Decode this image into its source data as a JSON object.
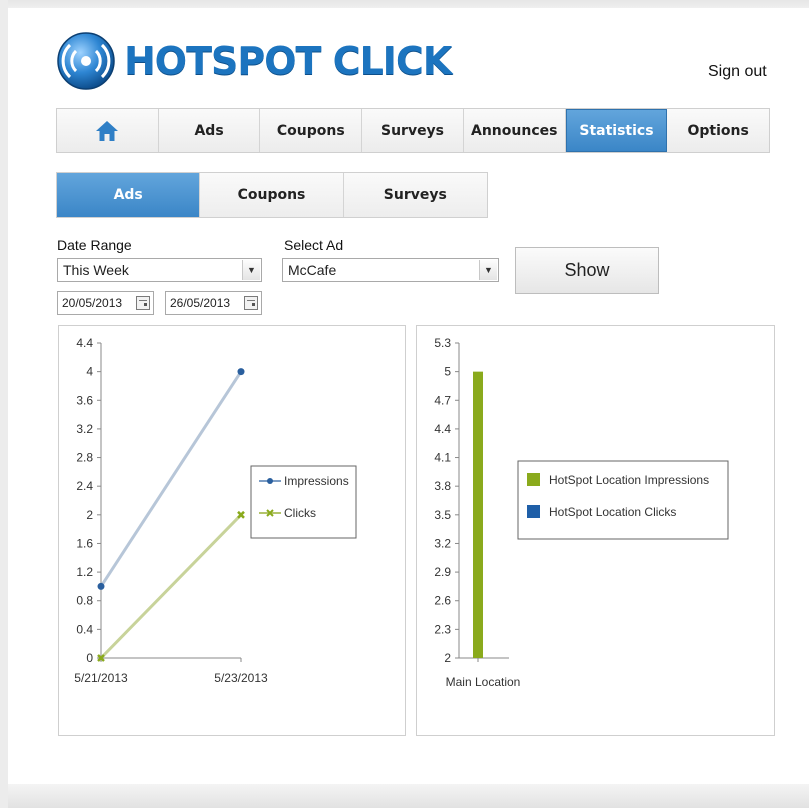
{
  "brand": {
    "name": "HOTSPOT CLICK",
    "logo_icon": "wifi-broadcast-icon",
    "color": "#1c74bf"
  },
  "header": {
    "signout_label": "Sign out"
  },
  "main_nav": {
    "home_icon": "home-icon",
    "tabs": [
      "Ads",
      "Coupons",
      "Surveys",
      "Announces",
      "Statistics",
      "Options"
    ],
    "active": "Statistics"
  },
  "sub_nav": {
    "tabs": [
      "Ads",
      "Coupons",
      "Surveys"
    ],
    "active": "Ads"
  },
  "filters": {
    "date_range_label": "Date Range",
    "date_range_value": "This Week",
    "select_ad_label": "Select Ad",
    "select_ad_value": "McCafe",
    "start_date": "20/05/2013",
    "end_date": "26/05/2013",
    "show_label": "Show"
  },
  "chart_data": [
    {
      "type": "line",
      "x": [
        "5/21/2013",
        "5/23/2013"
      ],
      "ylim": [
        0,
        4.4
      ],
      "yticks": [
        "0",
        "0.4",
        "0.8",
        "1.2",
        "1.6",
        "2",
        "2.4",
        "2.8",
        "3.2",
        "3.6",
        "4",
        "4.4"
      ],
      "series": [
        {
          "name": "Impressions",
          "values": [
            1,
            4
          ],
          "color": "#2a5f9e"
        },
        {
          "name": "Clicks",
          "values": [
            0,
            2
          ],
          "color": "#8aaa1c"
        }
      ],
      "legend": "right"
    },
    {
      "type": "bar",
      "categories": [
        "Main Location"
      ],
      "ylim": [
        2,
        5.3
      ],
      "yticks": [
        "2",
        "2.3",
        "2.6",
        "2.9",
        "3.2",
        "3.5",
        "3.8",
        "4.1",
        "4.4",
        "4.7",
        "5",
        "5.3"
      ],
      "series": [
        {
          "name": "HotSpot Location Impressions",
          "values": [
            5
          ],
          "color": "#8aaa1c"
        },
        {
          "name": "HotSpot Location Clicks",
          "values": [
            0
          ],
          "color": "#1f5fa8"
        }
      ],
      "legend": "right"
    }
  ]
}
